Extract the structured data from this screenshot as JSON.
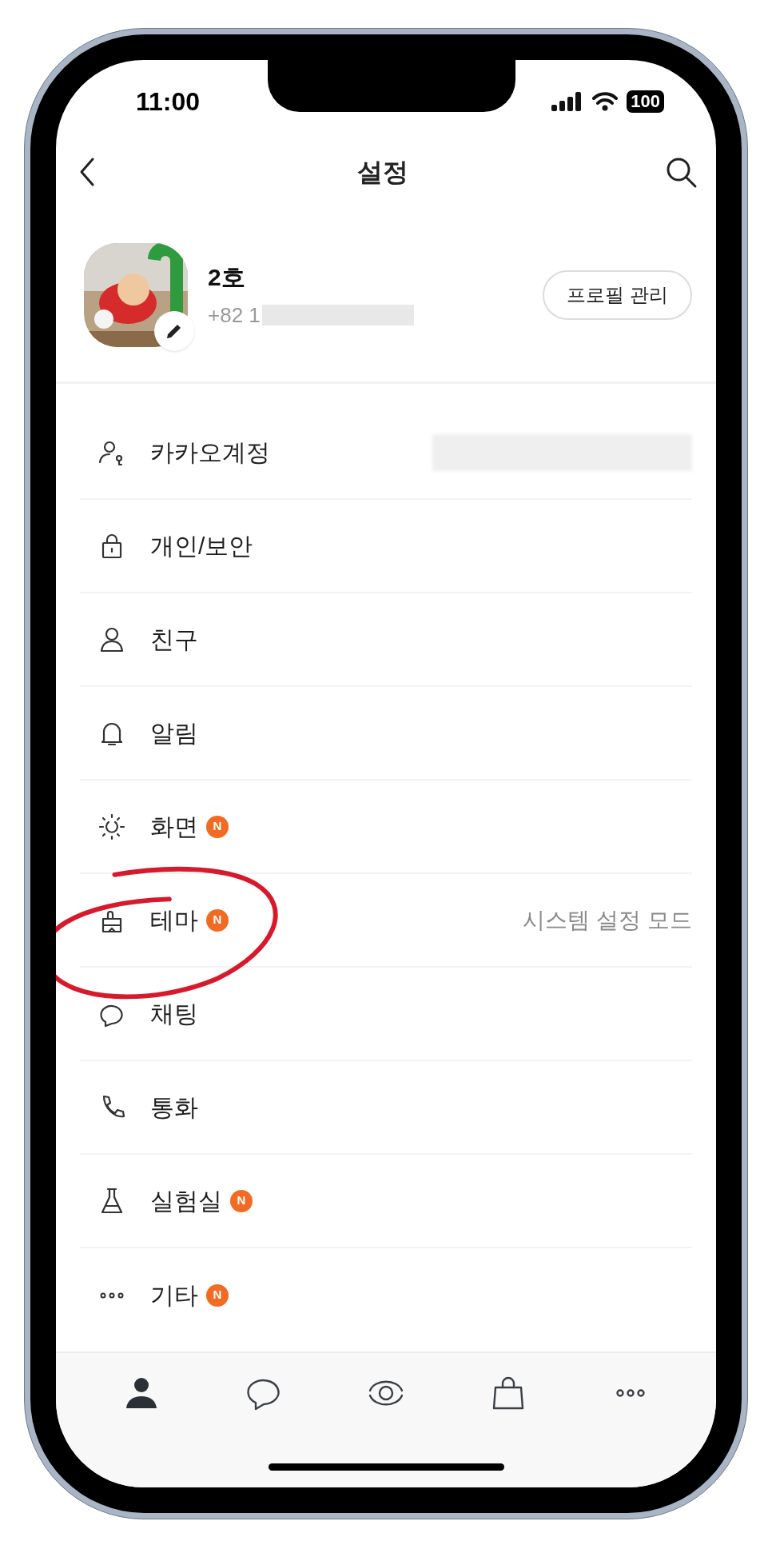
{
  "status_bar": {
    "time": "11:00",
    "battery": "100"
  },
  "header": {
    "title": "설정"
  },
  "profile": {
    "name": "2호",
    "phone": "+82 1",
    "button": "프로필 관리"
  },
  "menu": [
    {
      "kind": "account",
      "label": "카카오계정",
      "redacted": true
    },
    {
      "kind": "lock",
      "label": "개인/보안"
    },
    {
      "kind": "person",
      "label": "친구"
    },
    {
      "kind": "bell",
      "label": "알림"
    },
    {
      "kind": "sun",
      "label": "화면",
      "badge": "N"
    },
    {
      "kind": "brush",
      "label": "테마",
      "badge": "N",
      "value": "시스템 설정 모드"
    },
    {
      "kind": "chat",
      "label": "채팅"
    },
    {
      "kind": "phone",
      "label": "통화"
    },
    {
      "kind": "flask",
      "label": "실험실",
      "badge": "N"
    },
    {
      "kind": "dots",
      "label": "기타",
      "badge": "N"
    }
  ],
  "tab_bar": [
    {
      "kind": "friends",
      "selected": true
    },
    {
      "kind": "chats",
      "selected": false
    },
    {
      "kind": "view",
      "selected": false
    },
    {
      "kind": "shop",
      "selected": false
    },
    {
      "kind": "more",
      "selected": false
    }
  ]
}
